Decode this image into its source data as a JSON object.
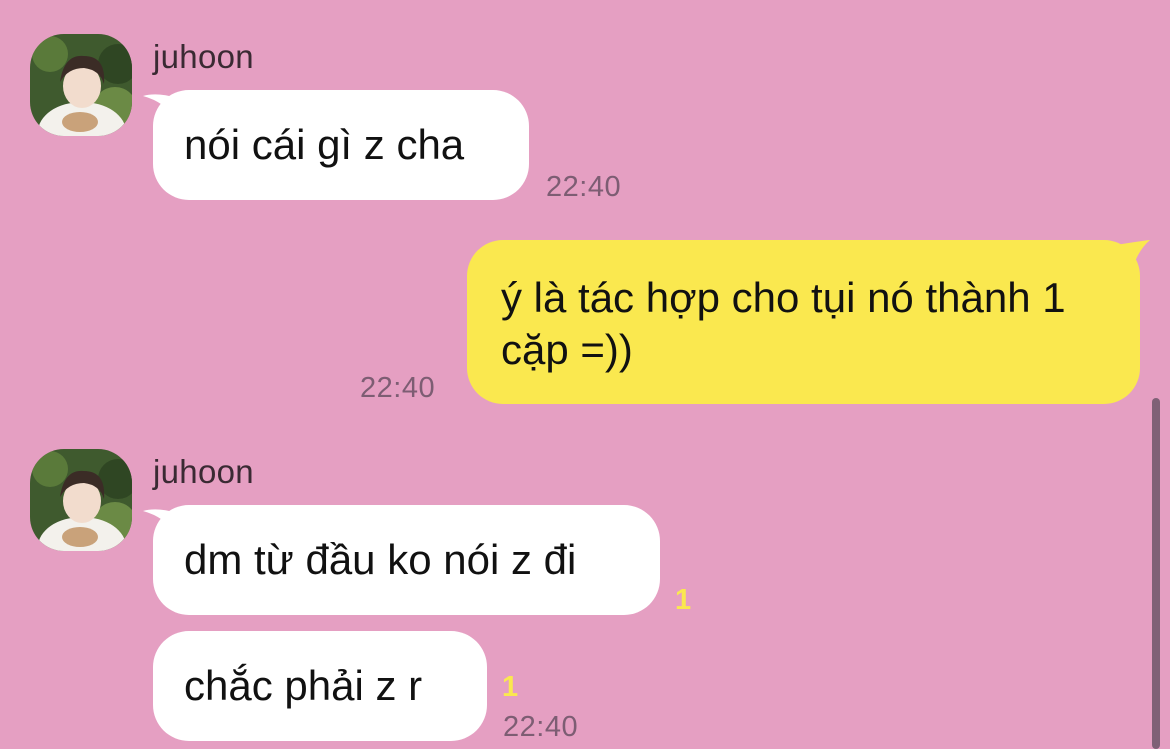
{
  "theme": {
    "background": "#e59fc2",
    "incoming_bubble": "#ffffff",
    "outgoing_bubble": "#fae84f",
    "time_color": "#7d5d73",
    "unread_color": "#fae84f"
  },
  "messages": {
    "group1": {
      "sender": "juhoon",
      "avatar_icon": "profile-photo-icon",
      "bubble1": {
        "text": "nói cái gì z cha",
        "time": "22:40"
      }
    },
    "group2": {
      "bubble1": {
        "text": "ý là tác hợp cho tụi nó thành 1 cặp =))",
        "time": "22:40"
      }
    },
    "group3": {
      "sender": "juhoon",
      "avatar_icon": "profile-photo-icon",
      "bubble1": {
        "text": "dm từ đầu ko nói z đi",
        "unread": "1"
      },
      "bubble2": {
        "text": "chắc phải z r",
        "unread": "1",
        "time": "22:40"
      }
    }
  }
}
